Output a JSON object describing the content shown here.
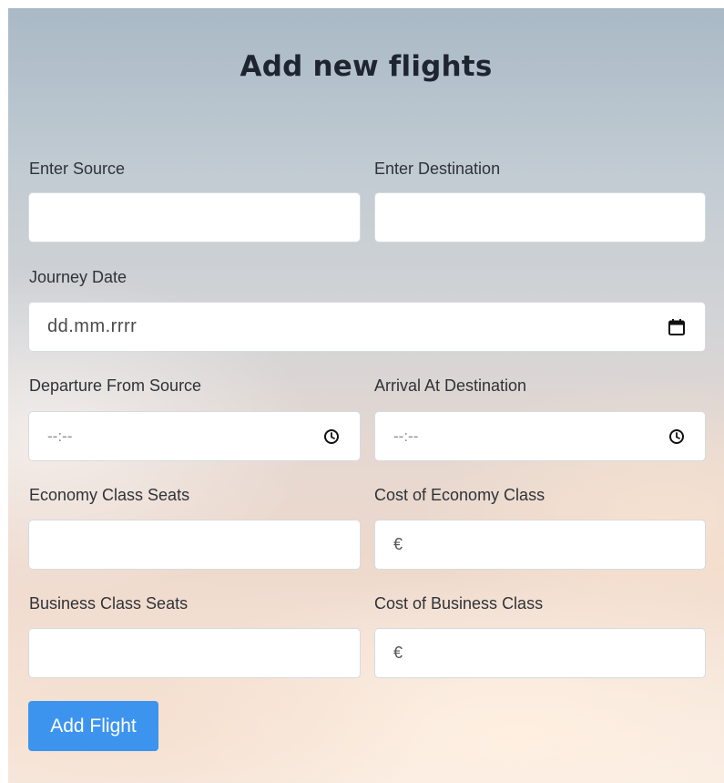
{
  "form": {
    "title": "Add new flights",
    "source_label": "Enter Source",
    "destination_label": "Enter Destination",
    "journey_date_label": "Journey Date",
    "journey_date_value": "dd.mm.rrrr",
    "departure_label": "Departure From Source",
    "departure_value": "--:--",
    "arrival_label": "Arrival At Destination",
    "arrival_value": "--:--",
    "economy_seats_label": "Economy Class Seats",
    "economy_cost_label": "Cost of Economy Class",
    "economy_cost_prefix": "€",
    "business_seats_label": "Business Class Seats",
    "business_cost_label": "Cost of Business Class",
    "business_cost_prefix": "€",
    "submit_label": "Add Flight"
  },
  "colors": {
    "button": "#3d94ee",
    "title": "#1f2530"
  },
  "icons": {
    "date": "calendar-icon",
    "time": "clock-icon"
  }
}
